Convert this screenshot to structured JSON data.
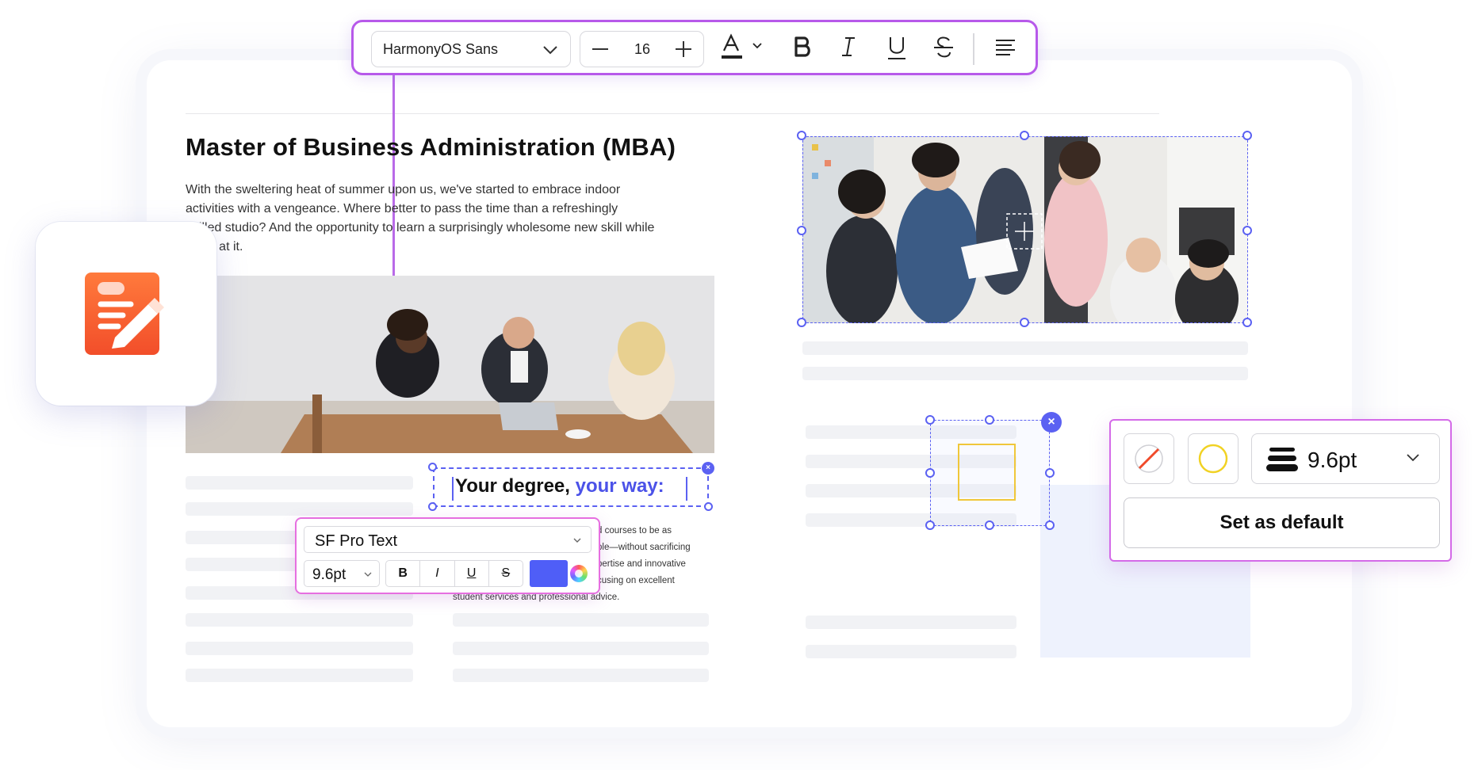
{
  "toolbar": {
    "font_family": "HarmonyOS Sans",
    "font_size": "16"
  },
  "article": {
    "title": "Master of Business Administration (MBA)",
    "intro_lines": [
      "With the sweltering heat of summer upon us, we've started to embrace indoor",
      "activities with a vengeance. Where better to pass the time than a refreshingly",
      "chilled studio? And the opportunity to learn a surprisingly wholesome new skill while",
      "we're at it."
    ],
    "heading_part1": "Your degree, ",
    "heading_part2": "your way:",
    "body_lines": [
      "d courses to be as",
      "ple—without sacrificing",
      "pertise and innovative",
      "cusing on excellent",
      "student services and professional advice."
    ]
  },
  "text_popover": {
    "font_family": "SF Pro Text",
    "font_size": "9.6pt",
    "bold": "B",
    "italic": "I",
    "underline": "U",
    "strike": "S",
    "color": "#4f5ef7"
  },
  "shape_popover": {
    "stroke_width": "9.6pt",
    "set_default_label": "Set as default"
  },
  "colors": {
    "accent_purple": "#b759ea",
    "selection_blue": "#5b61f2",
    "app_orange": "#ff6a3a"
  }
}
